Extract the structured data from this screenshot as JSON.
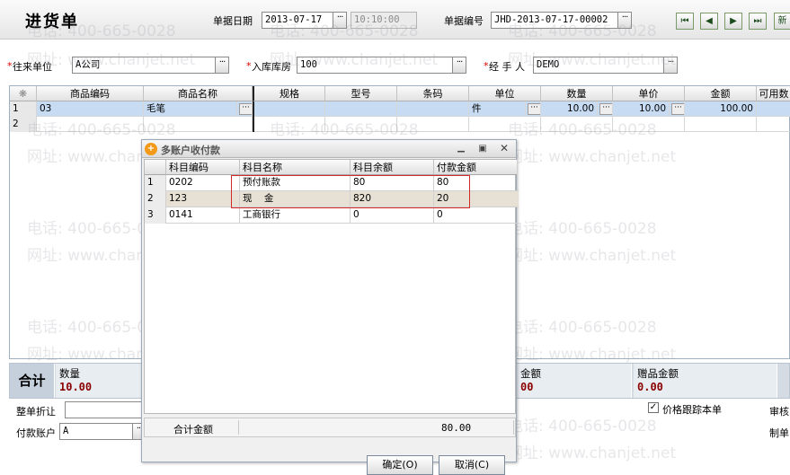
{
  "header": {
    "title": "进货单",
    "doc_date_label": "单据日期",
    "doc_date_value": "2013-07-17",
    "doc_time_value": "10:10:00",
    "doc_no_label": "单据编号",
    "doc_no_value": "JHD-2013-07-17-00002",
    "nav": [
      "⏮",
      "◀",
      "▶",
      "⏭"
    ],
    "right_button_label": "新"
  },
  "fields": {
    "partner_label": "往来单位",
    "partner_value": "A公司",
    "warehouse_label": "入库库房",
    "warehouse_value": "100",
    "handler_label": "经 手 人",
    "handler_value": "DEMO"
  },
  "grid": {
    "corner": "❋",
    "columns": [
      "商品编码",
      "商品名称",
      "规格",
      "型号",
      "条码",
      "单位",
      "数量",
      "单价",
      "金额",
      "可用数"
    ],
    "rows": [
      {
        "idx": "1",
        "code": "03",
        "name": "毛笔",
        "spec": "",
        "model": "",
        "barcode": "",
        "unit": "件",
        "qty": "10.00",
        "price": "10.00",
        "amount": "100.00",
        "avail": ""
      },
      {
        "idx": "2",
        "code": "",
        "name": "",
        "spec": "",
        "model": "",
        "barcode": "",
        "unit": "",
        "qty": "",
        "price": "",
        "amount": "",
        "avail": ""
      }
    ]
  },
  "totals": {
    "label": "合计",
    "qty_label": "数量",
    "qty_value": "10.00",
    "amount_label": "金额",
    "amount_value": "00",
    "gift_label": "赠品金额",
    "gift_value": "0.00"
  },
  "bottom": {
    "discount_label": "整单折让",
    "pay_account_label": "付款账户",
    "pay_account_value": "A",
    "price_track_label": "价格跟踪本单",
    "audit_label": "审核",
    "maker_label": "制单"
  },
  "dialog": {
    "title": "多账户收付款",
    "columns": [
      "科目编码",
      "科目名称",
      "科目余额",
      "付款金额"
    ],
    "rows": [
      {
        "idx": "1",
        "code": "0202",
        "name": "预付账款",
        "balance": "80",
        "payment": "80"
      },
      {
        "idx": "2",
        "code": "123",
        "name": "现    金",
        "balance": "820",
        "payment": "20"
      },
      {
        "idx": "3",
        "code": "0141",
        "name": "工商银行",
        "balance": "0",
        "payment": "0"
      }
    ],
    "total_label": "合计金额",
    "total_value": "80.00",
    "ok_label": "确定(O)",
    "cancel_label": "取消(C)"
  },
  "watermark": {
    "phone": "电话: 400-665-0028",
    "site": "网址: www.chanjet.net"
  },
  "colors": {
    "selected_row": "#c7dcf3",
    "total_value": "#8b0000",
    "highlight_box": "#d42a2a"
  }
}
